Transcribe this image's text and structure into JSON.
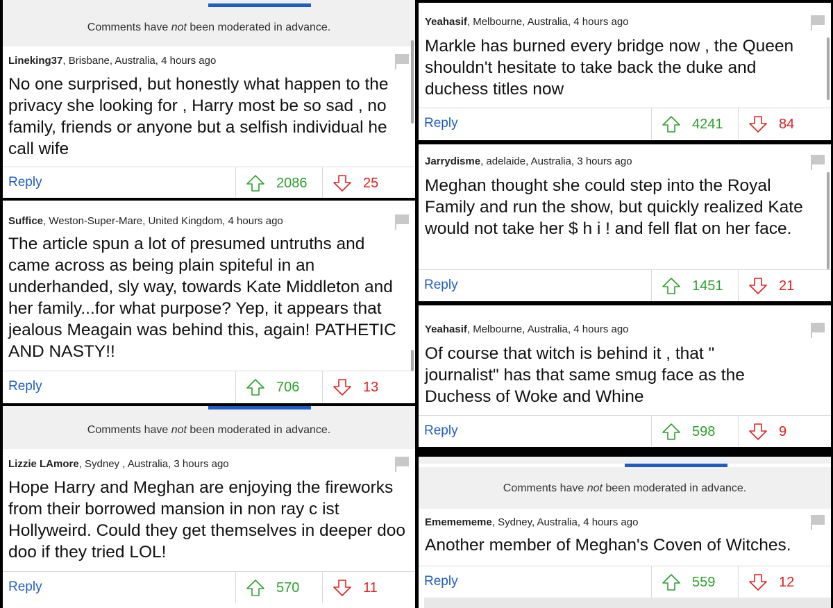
{
  "moderation_notice": {
    "pre": "Comments have ",
    "em": "not",
    "post": " been moderated in advance."
  },
  "reply_label": "Reply",
  "comments": [
    {
      "user": "Lineking37",
      "location_time": ", Brisbane, Australia, 4 hours ago",
      "text": "No one surprised, but honestly what happen to the privacy she looking for , Harry most be so sad , no family, friends or anyone but a selfish individual he call wife",
      "upvotes": "2086",
      "downvotes": "25"
    },
    {
      "user": "Suffice",
      "location_time": ", Weston-Super-Mare, United Kingdom, 4 hours ago",
      "text": "The article spun a lot of presumed untruths and came across as being plain spiteful in an underhanded, sly  way, towards Kate Middleton and her family...for what purpose? Yep, it appears that  jealous Meagain was behind this, again! PATHETIC AND NASTY!!",
      "upvotes": "706",
      "downvotes": "13"
    },
    {
      "user": "Lizzie LAmore",
      "location_time": ", Sydney , Australia, 3 hours ago",
      "text": "Hope Harry and Meghan are enjoying the fireworks from their borrowed mansion in non ray c ist Hollyweird. Could they get themselves in deeper doo doo if they tried LOL!",
      "upvotes": "570",
      "downvotes": "11"
    },
    {
      "user": "Yeahasif",
      "location_time": ", Melbourne, Australia, 4 hours ago",
      "text": "Markle has burned every bridge now , the Queen shouldn't hesitate to take back the duke and duchess titles now",
      "upvotes": "4241",
      "downvotes": "84"
    },
    {
      "user": "Jarrydisme",
      "location_time": ", adelaide, Australia, 3 hours ago",
      "text": "Meghan thought she could step into the Royal Family and run the show, but quickly realized Kate would not take her $ h i ! and fell flat on her face.",
      "upvotes": "1451",
      "downvotes": "21"
    },
    {
      "user": "Yeahasif",
      "location_time": ", Melbourne, Australia, 4 hours ago",
      "text": "Of course that witch is behind it , that \" journalist\" has that same smug face as the Duchess of Woke and Whine",
      "upvotes": "598",
      "downvotes": "9"
    },
    {
      "user": "Ememememe",
      "location_time": ", Sydney, Australia, 4 hours ago",
      "text": "Another member of Meghan's Coven of Witches.",
      "upvotes": "559",
      "downvotes": "12"
    }
  ],
  "colors": {
    "upvote": "#2ca02c",
    "downvote": "#e02020",
    "reply": "#1f5dc4",
    "accent_line": "#1f5dc4"
  },
  "icons": {
    "flag": "flag-icon",
    "upvote": "arrow-up-icon",
    "downvote": "arrow-down-icon"
  }
}
